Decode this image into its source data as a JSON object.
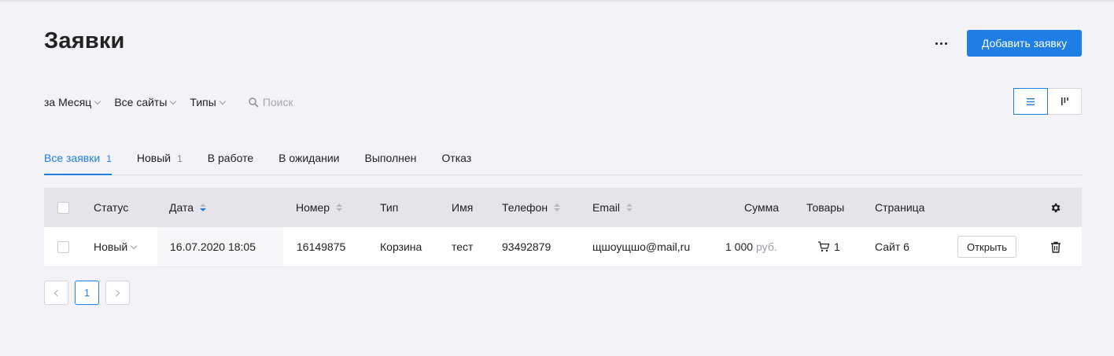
{
  "header": {
    "title": "Заявки",
    "more_icon": "more-dots-icon",
    "add_button": "Добавить заявку",
    "accent_color": "#1e7ee4"
  },
  "filters": {
    "period": "за Месяц",
    "sites": "Все сайты",
    "types": "Типы",
    "search_placeholder": "Поиск",
    "search_icon": "search-icon"
  },
  "view_toggle": {
    "list_icon": "list-view-icon",
    "kanban_icon": "kanban-view-icon",
    "active": "list"
  },
  "tabs": [
    {
      "label": "Все заявки",
      "count": "1",
      "active": true
    },
    {
      "label": "Новый",
      "count": "1",
      "active": false
    },
    {
      "label": "В работе",
      "count": "",
      "active": false
    },
    {
      "label": "В ожидании",
      "count": "",
      "active": false
    },
    {
      "label": "Выполнен",
      "count": "",
      "active": false
    },
    {
      "label": "Отказ",
      "count": "",
      "active": false
    }
  ],
  "table": {
    "columns": {
      "status": "Статус",
      "date": "Дата",
      "number": "Номер",
      "type": "Тип",
      "name": "Имя",
      "phone": "Телефон",
      "email": "Email",
      "sum": "Сумма",
      "goods": "Товары",
      "page": "Страница"
    },
    "settings_icon": "gear-icon",
    "rows": [
      {
        "status": "Новый",
        "date": "16.07.2020 18:05",
        "number": "16149875",
        "type": "Корзина",
        "name": "тест",
        "phone": "93492879",
        "email": "щшоущшо@mail,ru",
        "sum": "1 000",
        "currency": "руб.",
        "goods_icon": "cart-icon",
        "goods": "1",
        "page": "Сайт 6",
        "open_button": "Открыть",
        "delete_icon": "trash-icon"
      }
    ]
  },
  "pagination": {
    "current_page": "1",
    "prev_icon": "chevron-left-icon",
    "next_icon": "chevron-right-icon"
  }
}
